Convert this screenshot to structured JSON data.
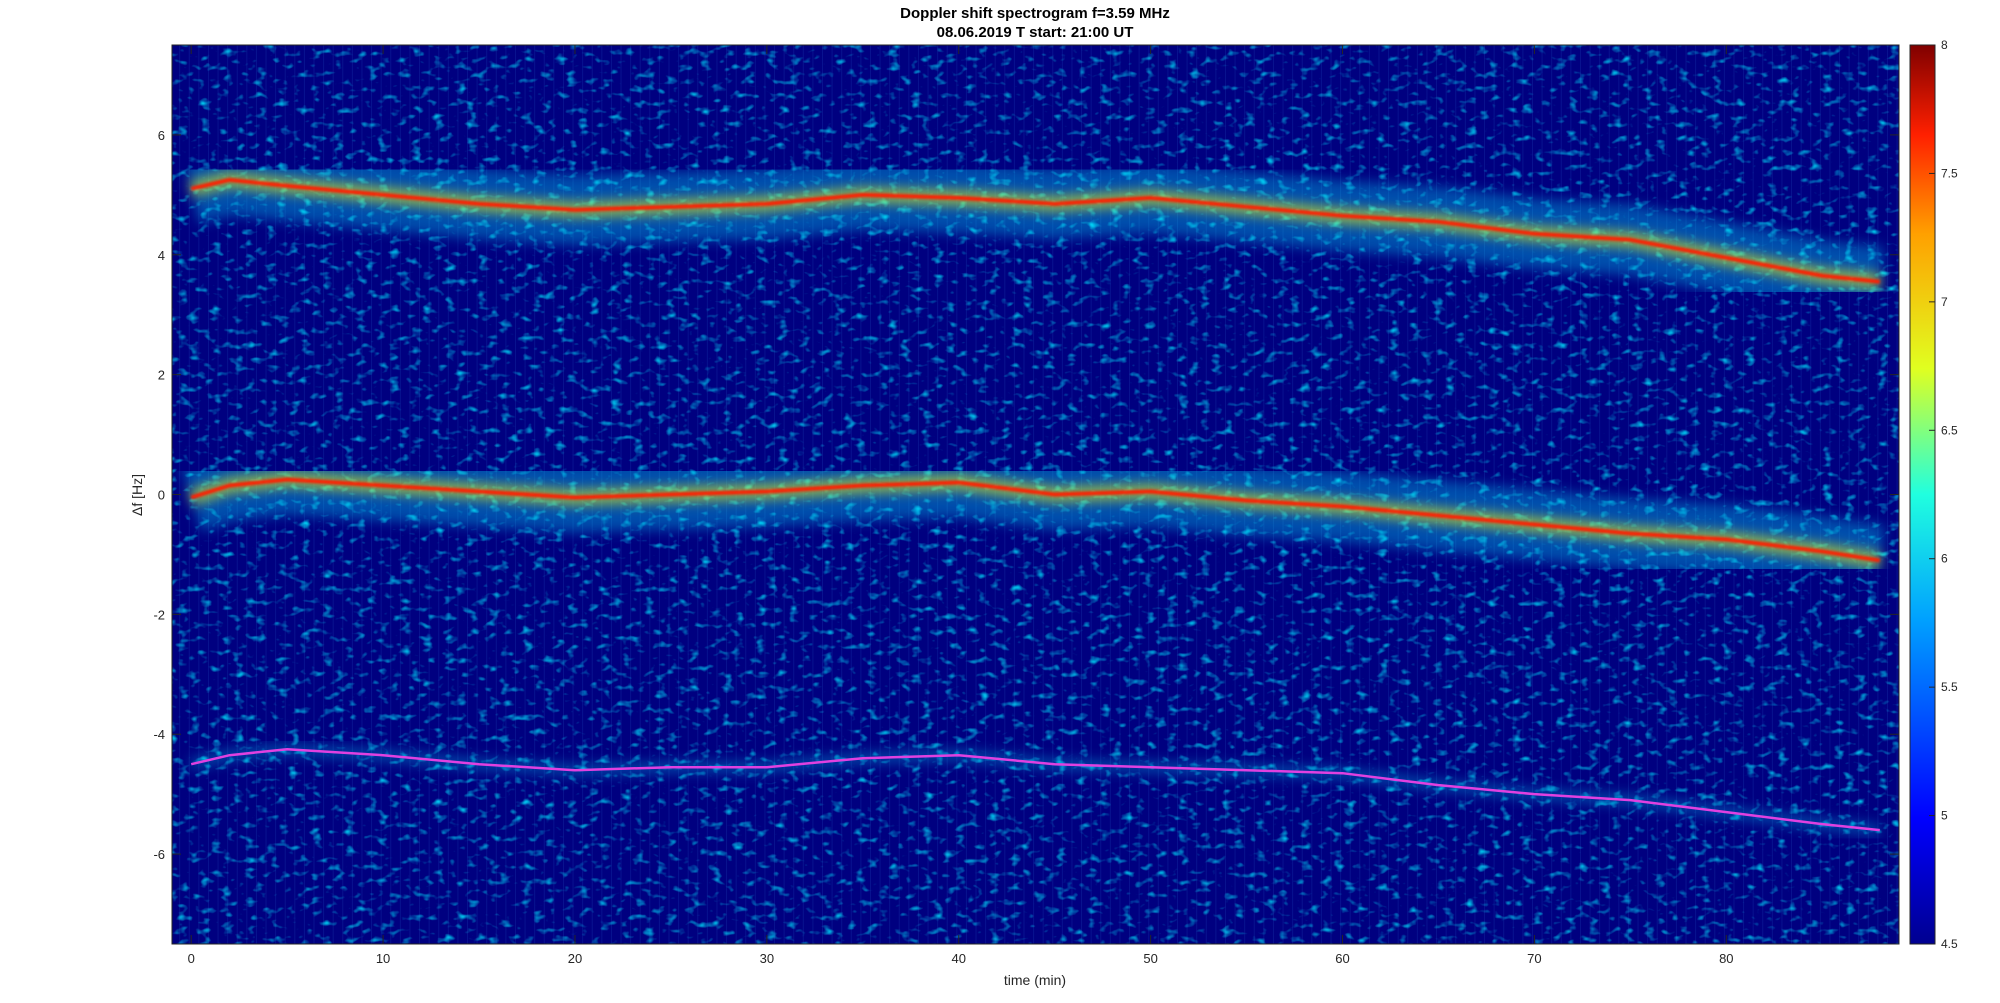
{
  "chart_data": {
    "type": "heatmap",
    "title": "Doppler shift spectrogram f=3.59 MHz",
    "subtitle": "08.06.2019   T start: 21:00 UT",
    "xlabel": "time (min)",
    "ylabel": "Δf [Hz]",
    "xlim": [
      -1,
      89
    ],
    "ylim": [
      -7.5,
      7.5
    ],
    "x_ticks": [
      0,
      10,
      20,
      30,
      40,
      50,
      60,
      70,
      80
    ],
    "y_ticks": [
      6,
      4,
      2,
      0,
      -2,
      -4,
      -6
    ],
    "colormap": "jet",
    "colorbar": {
      "range": [
        4.5,
        8
      ],
      "ticks": [
        8,
        7.5,
        7,
        6.5,
        6,
        5.5,
        5,
        4.5
      ]
    },
    "grid": false,
    "series": [
      {
        "x": [
          0,
          2,
          5,
          10,
          15,
          20,
          25,
          30,
          35,
          40,
          45,
          50,
          55,
          60,
          65,
          70,
          75,
          80,
          85,
          88
        ],
        "values": [
          5.1,
          5.25,
          5.15,
          5.0,
          4.85,
          4.75,
          4.8,
          4.85,
          5.0,
          4.95,
          4.85,
          4.95,
          4.8,
          4.65,
          4.55,
          4.35,
          4.25,
          3.95,
          3.65,
          3.55
        ]
      },
      {
        "x": [
          0,
          2,
          5,
          10,
          15,
          20,
          25,
          30,
          35,
          40,
          45,
          50,
          55,
          60,
          65,
          70,
          75,
          80,
          85,
          88
        ],
        "values": [
          -0.05,
          0.15,
          0.25,
          0.15,
          0.05,
          -0.05,
          0.0,
          0.05,
          0.15,
          0.2,
          0.0,
          0.05,
          -0.1,
          -0.2,
          -0.35,
          -0.5,
          -0.65,
          -0.75,
          -0.95,
          -1.1
        ]
      },
      {
        "x": [
          0,
          2,
          5,
          10,
          15,
          20,
          25,
          30,
          35,
          40,
          45,
          50,
          55,
          60,
          65,
          70,
          75,
          80,
          85,
          88
        ],
        "values": [
          -4.5,
          -4.35,
          -4.25,
          -4.35,
          -4.5,
          -4.6,
          -4.55,
          -4.55,
          -4.4,
          -4.35,
          -4.5,
          -4.55,
          -4.6,
          -4.65,
          -4.85,
          -5.0,
          -5.1,
          -5.3,
          -5.5,
          -5.6
        ]
      }
    ]
  },
  "colors": {
    "background": "#000080",
    "ridge": "#ff1a00",
    "ridge_halo": "#ffff00",
    "weak_ridge": "#e040e0"
  }
}
